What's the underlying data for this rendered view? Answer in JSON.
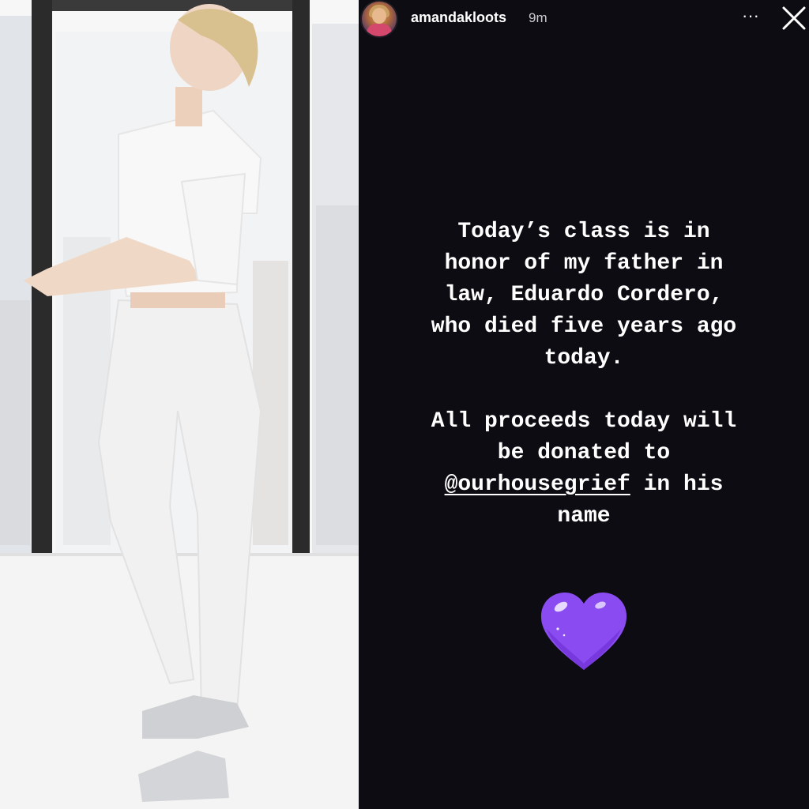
{
  "story": {
    "username": "amandakloots",
    "time_ago": "9m",
    "more_icon": "ellipsis-icon",
    "close_icon": "close-icon",
    "more_glyph": "···",
    "text_lines_1": [
      "Today’s class is in",
      "honor of my father in",
      "law, Eduardo Cordero,",
      "who died five years ago",
      "today."
    ],
    "text_lines_2": [
      "All proceeds today will",
      "be donated to"
    ],
    "mention": "@ourhousegrief",
    "mention_suffix": " in his",
    "last_line": "name",
    "sticker": "purple-heart",
    "heart_color": "#8a4cf0"
  },
  "photo": {
    "subject": "woman-in-white-outfit"
  }
}
